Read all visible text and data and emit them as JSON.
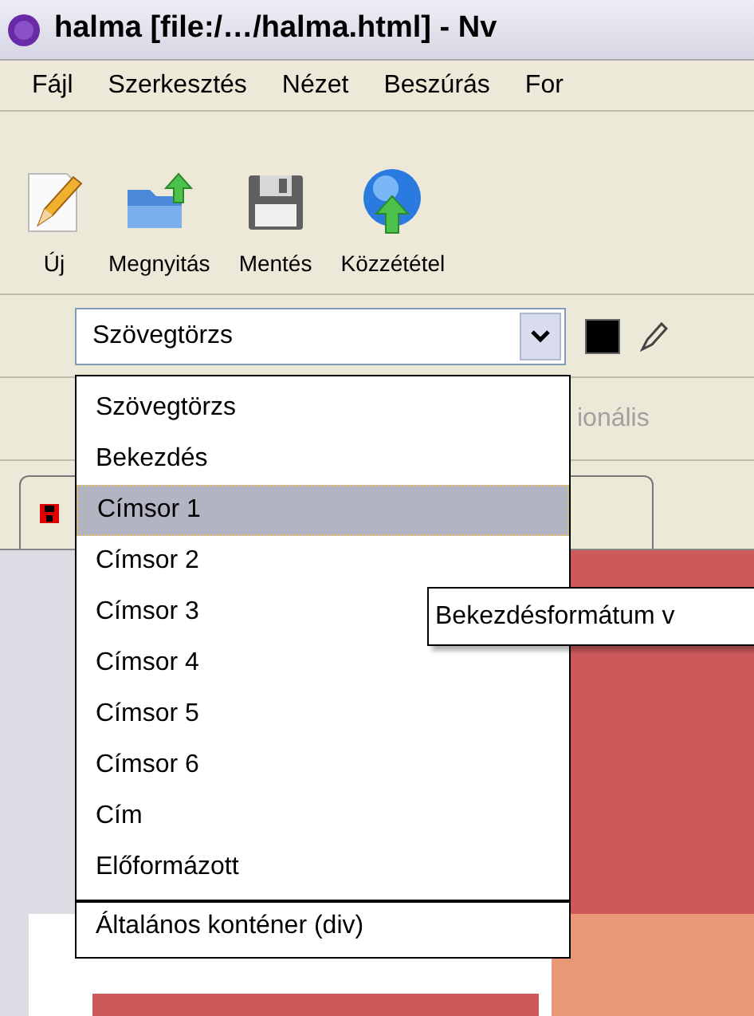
{
  "window": {
    "title": "halma [file:/…/halma.html] - Nv"
  },
  "menu": [
    "Fájl",
    "Szerkesztés",
    "Nézet",
    "Beszúrás",
    "For"
  ],
  "toolbar": [
    {
      "label": "Új",
      "kind": "new"
    },
    {
      "label": "Megnyitás",
      "kind": "open"
    },
    {
      "label": "Mentés",
      "kind": "save"
    },
    {
      "label": "Közzététel",
      "kind": "publish"
    }
  ],
  "format_toolbar": {
    "paragraph_format": "Szövegtörzs"
  },
  "edit_mode_toolbar": {
    "label": "ionális",
    "disabled": true
  },
  "format_dropdown": [
    {
      "label": "Szövegtörzs",
      "selected": false,
      "divider_above": false
    },
    {
      "label": "Bekezdés",
      "selected": false,
      "divider_above": false
    },
    {
      "label": "Címsor 1",
      "selected": true,
      "divider_above": false
    },
    {
      "label": "Címsor 2",
      "selected": false,
      "divider_above": false
    },
    {
      "label": "Címsor 3",
      "selected": false,
      "divider_above": false
    },
    {
      "label": "Címsor 4",
      "selected": false,
      "divider_above": false
    },
    {
      "label": "Címsor 5",
      "selected": false,
      "divider_above": false
    },
    {
      "label": "Címsor 6",
      "selected": false,
      "divider_above": false
    },
    {
      "label": "Cím",
      "selected": false,
      "divider_above": false
    },
    {
      "label": "Előformázott",
      "selected": false,
      "divider_above": false
    },
    {
      "label": "Általános konténer (div)",
      "selected": false,
      "divider_above": true
    }
  ],
  "tooltip": "Bekezdésformátum v"
}
